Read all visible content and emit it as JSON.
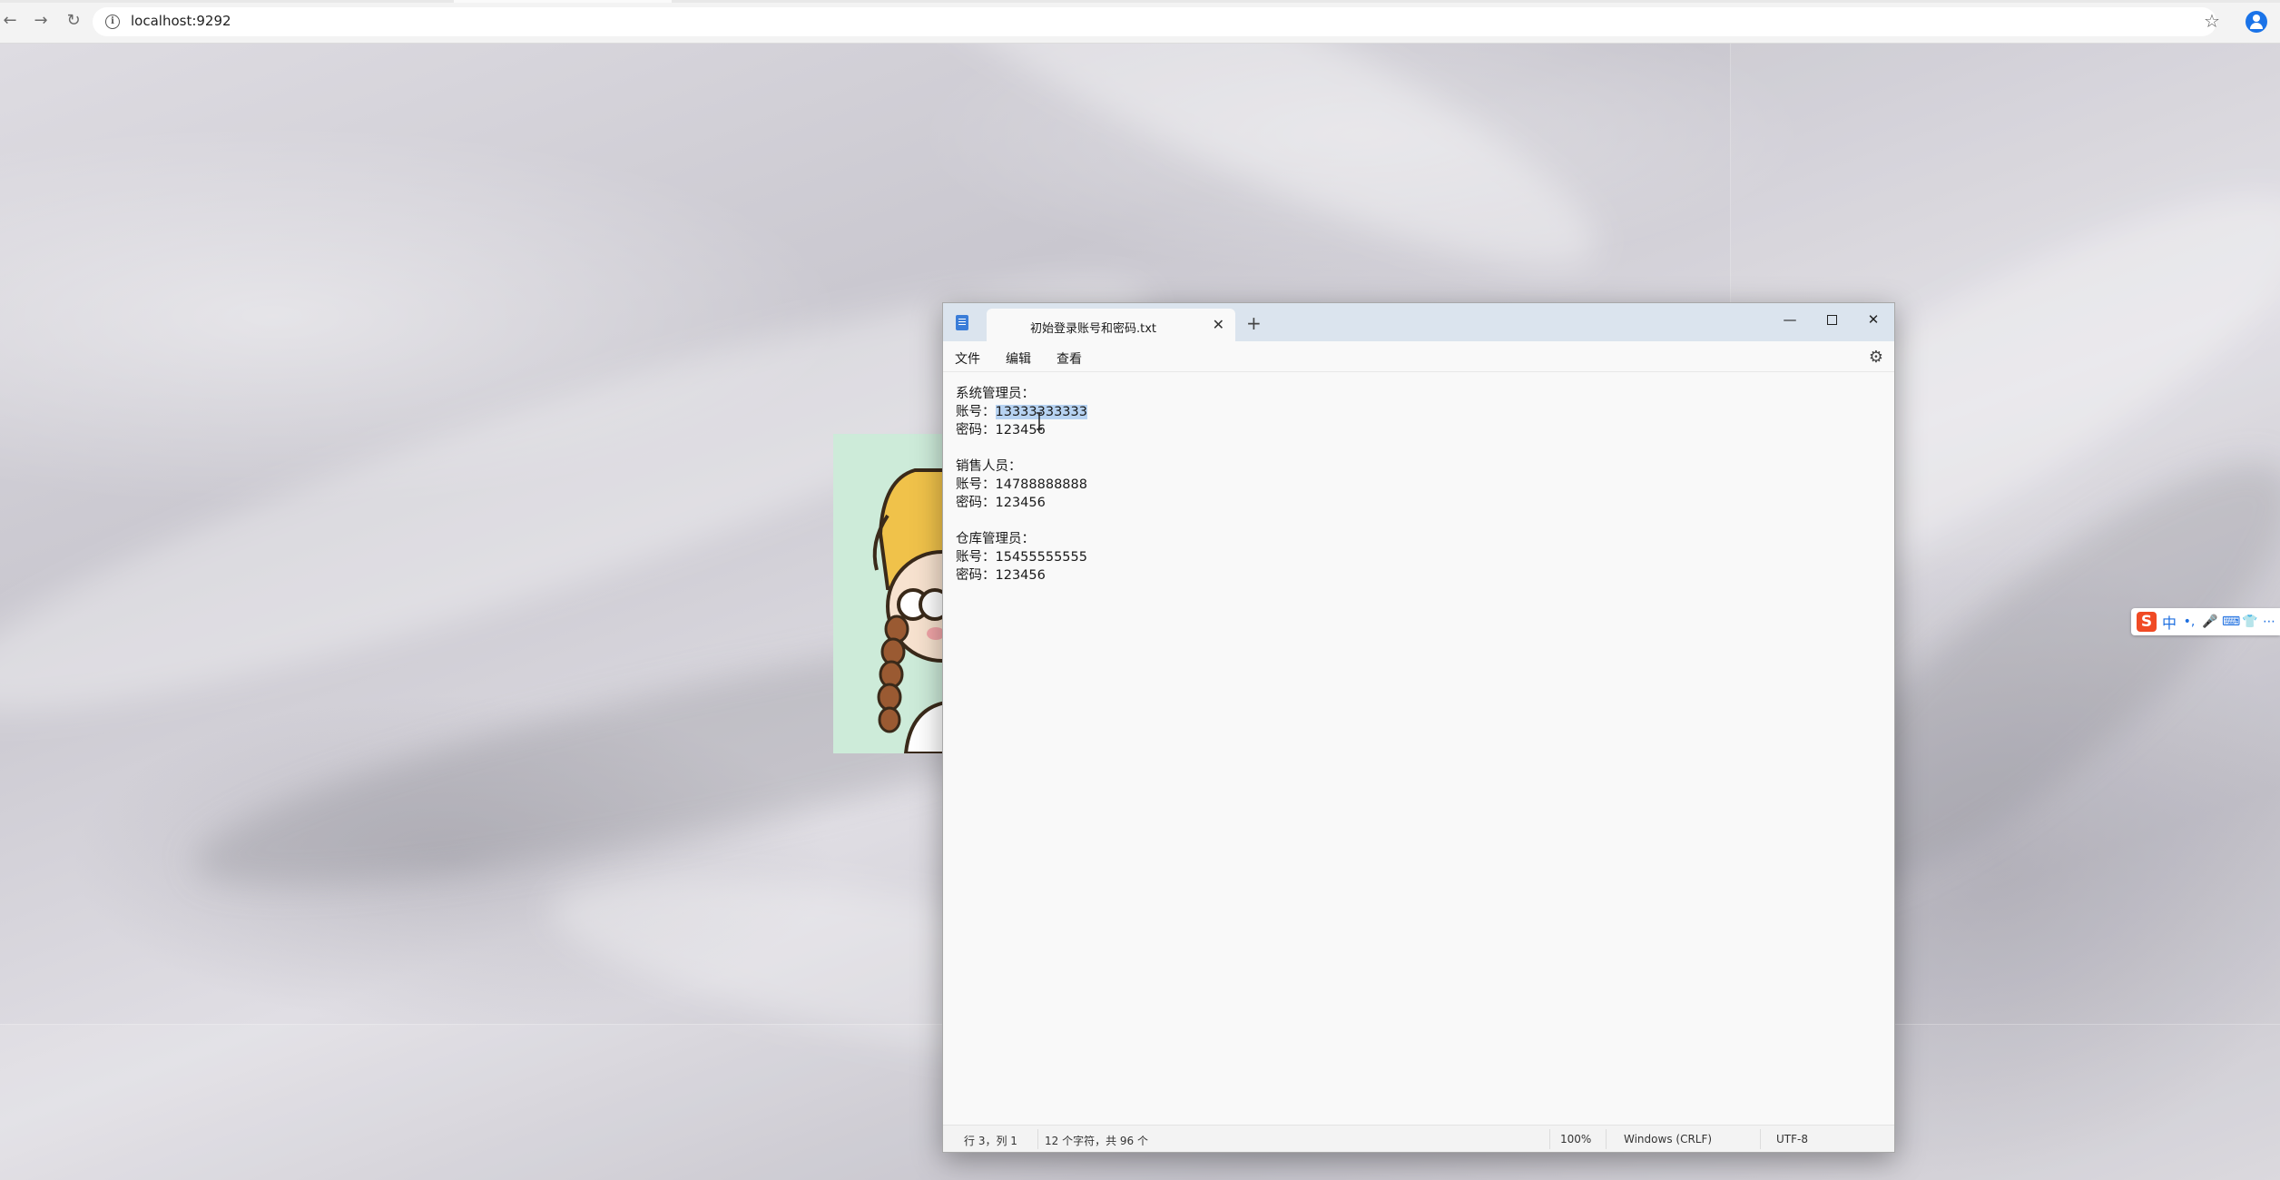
{
  "browser": {
    "url": "localhost:9292",
    "back_icon": "←",
    "forward_icon": "→",
    "reload_icon": "↻",
    "star_icon": "☆"
  },
  "ime": {
    "logo": "S",
    "mode": "中",
    "punct": "•,",
    "mic": "🎤",
    "keyboard": "⌨",
    "skin": "👕",
    "more": "⋯"
  },
  "notepad": {
    "tab_title": "初始登录账号和密码.txt",
    "menu": {
      "file": "文件",
      "edit": "编辑",
      "view": "查看"
    },
    "lines": {
      "admin_heading": "系统管理员：",
      "admin_account_label": "账号：",
      "admin_account_value": "13333333333",
      "admin_password": "密码：123456",
      "sales_heading": "销售人员：",
      "sales_account": "账号：14788888888",
      "sales_password": "密码：123456",
      "warehouse_heading": "仓库管理员：",
      "warehouse_account": "账号：15455555555",
      "warehouse_password": "密码：123456"
    },
    "status": {
      "position": "行 3，列 1",
      "chars": "12 个字符，共 96 个",
      "zoom": "100%",
      "line_ending": "Windows (CRLF)",
      "encoding": "UTF-8"
    }
  }
}
